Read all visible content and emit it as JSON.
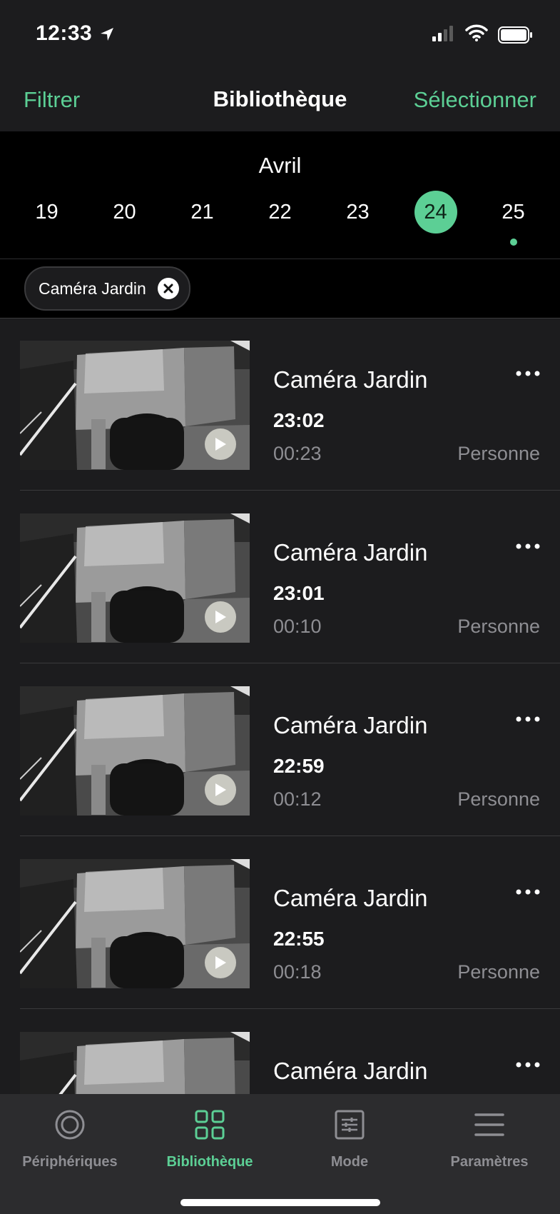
{
  "status_bar": {
    "time": "12:33"
  },
  "nav": {
    "left": "Filtrer",
    "title": "Bibliothèque",
    "right": "Sélectionner"
  },
  "calendar": {
    "month": "Avril",
    "days": [
      "19",
      "20",
      "21",
      "22",
      "23",
      "24",
      "25"
    ],
    "selected_day": "24",
    "marked_day": "25"
  },
  "filter": {
    "chip_label": "Caméra Jardin"
  },
  "events": [
    {
      "camera": "Caméra Jardin",
      "time": "23:02",
      "duration": "00:23",
      "tag": "Personne"
    },
    {
      "camera": "Caméra Jardin",
      "time": "23:01",
      "duration": "00:10",
      "tag": "Personne"
    },
    {
      "camera": "Caméra Jardin",
      "time": "22:59",
      "duration": "00:12",
      "tag": "Personne"
    },
    {
      "camera": "Caméra Jardin",
      "time": "22:55",
      "duration": "00:18",
      "tag": "Personne"
    },
    {
      "camera": "Caméra Jardin",
      "time": "",
      "duration": "",
      "tag": ""
    }
  ],
  "tabs": [
    {
      "label": "Périphériques",
      "icon": "devices-icon"
    },
    {
      "label": "Bibliothèque",
      "icon": "library-grid-icon"
    },
    {
      "label": "Mode",
      "icon": "mode-sliders-icon"
    },
    {
      "label": "Paramètres",
      "icon": "menu-icon"
    }
  ],
  "colors": {
    "accent": "#5ccf95",
    "background": "#1c1c1e",
    "secondary_text": "#8e8e93"
  }
}
